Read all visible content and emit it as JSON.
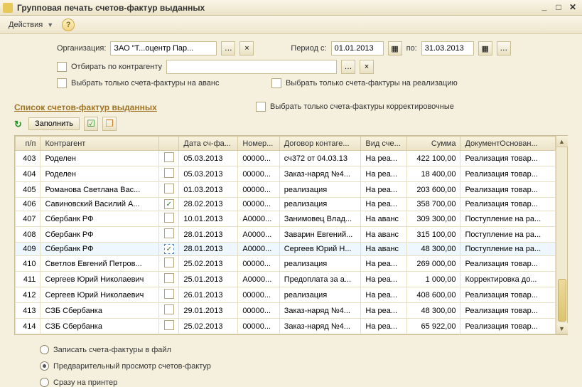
{
  "window": {
    "title": "Групповая печать счетов-фактур выданных"
  },
  "toolbar": {
    "actions_label": "Действия"
  },
  "form": {
    "org_label": "Организация:",
    "org_value": "ЗАО \"Т...оцентр Пар...",
    "period_from_label": "Период с:",
    "period_from": "01.01.2013",
    "period_to_label": "по:",
    "period_to": "31.03.2013",
    "filter_by_contractor": "Отбирать по контрагенту",
    "only_advance": "Выбрать только счета-фактуры на аванс",
    "only_realize": "Выбрать только счета-фактуры на реализацию",
    "only_correct": "Выбрать только счета-фактуры корректировочные"
  },
  "section": {
    "title": "Список счетов-фактур выданных",
    "fill_label": "Заполнить"
  },
  "columns": {
    "np": "п/п",
    "kontragent": "Контрагент",
    "chk": "",
    "date": "Дата сч-фа...",
    "num": "Номер...",
    "dog": "Договор контаге...",
    "vid": "Вид сче...",
    "sum": "Сумма",
    "doc": "ДокументОснован..."
  },
  "rows": [
    {
      "np": "403",
      "kon": "Роделен",
      "chk": false,
      "date": "05.03.2013",
      "num": "00000...",
      "dog": "сч372 от 04.03.13",
      "vid": "На реа...",
      "sum": "422 100,00",
      "doc": "Реализация товар..."
    },
    {
      "np": "404",
      "kon": "Роделен",
      "chk": false,
      "date": "05.03.2013",
      "num": "00000...",
      "dog": "Заказ-наряд №4...",
      "vid": "На реа...",
      "sum": "18 400,00",
      "doc": "Реализация товар..."
    },
    {
      "np": "405",
      "kon": "Романова Светлана Вас...",
      "chk": false,
      "date": "01.03.2013",
      "num": "00000...",
      "dog": "реализация",
      "vid": "На реа...",
      "sum": "203 600,00",
      "doc": "Реализация товар..."
    },
    {
      "np": "406",
      "kon": "Савиновский Василий А...",
      "chk": true,
      "date": "28.02.2013",
      "num": "00000...",
      "dog": "реализация",
      "vid": "На реа...",
      "sum": "358 700,00",
      "doc": "Реализация товар..."
    },
    {
      "np": "407",
      "kon": "Сбербанк РФ",
      "chk": false,
      "date": "10.01.2013",
      "num": "А0000...",
      "dog": "Занимовец Влад...",
      "vid": "На аванс",
      "sum": "309 300,00",
      "doc": "Поступление на ра..."
    },
    {
      "np": "408",
      "kon": "Сбербанк РФ",
      "chk": false,
      "date": "28.01.2013",
      "num": "А0000...",
      "dog": "Заварин Евгений...",
      "vid": "На аванс",
      "sum": "315 100,00",
      "doc": "Поступление на ра..."
    },
    {
      "np": "409",
      "kon": "Сбербанк РФ",
      "chk": true,
      "date": "28.01.2013",
      "num": "А0000...",
      "dog": "Сергеев Юрий Н...",
      "vid": "На аванс",
      "sum": "48 300,00",
      "doc": "Поступление на ра...",
      "selected": true
    },
    {
      "np": "410",
      "kon": "Светлов Евгений Петров...",
      "chk": false,
      "date": "25.02.2013",
      "num": "00000...",
      "dog": "реализация",
      "vid": "На реа...",
      "sum": "269 000,00",
      "doc": "Реализация товар..."
    },
    {
      "np": "411",
      "kon": "Сергеев Юрий Николаевич",
      "chk": false,
      "date": "25.01.2013",
      "num": "А0000...",
      "dog": "Предоплата за а...",
      "vid": "На реа...",
      "sum": "1 000,00",
      "doc": "Корректировка до..."
    },
    {
      "np": "412",
      "kon": "Сергеев Юрий Николаевич",
      "chk": false,
      "date": "26.01.2013",
      "num": "00000...",
      "dog": "реализация",
      "vid": "На реа...",
      "sum": "408 600,00",
      "doc": "Реализация товар..."
    },
    {
      "np": "413",
      "kon": "СЗБ Сбербанка",
      "chk": false,
      "date": "29.01.2013",
      "num": "00000...",
      "dog": "Заказ-наряд №4...",
      "vid": "На реа...",
      "sum": "48 300,00",
      "doc": "Реализация товар..."
    },
    {
      "np": "414",
      "kon": "СЗБ Сбербанка",
      "chk": false,
      "date": "25.02.2013",
      "num": "00000...",
      "dog": "Заказ-наряд №4...",
      "vid": "На реа...",
      "sum": "65 922,00",
      "doc": "Реализация товар..."
    }
  ],
  "radios": {
    "to_file": "Записать счета-фактуры в файл",
    "preview": "Предварительный просмотр счетов-фактур",
    "printer": "Сразу на принтер",
    "selected": "preview"
  }
}
